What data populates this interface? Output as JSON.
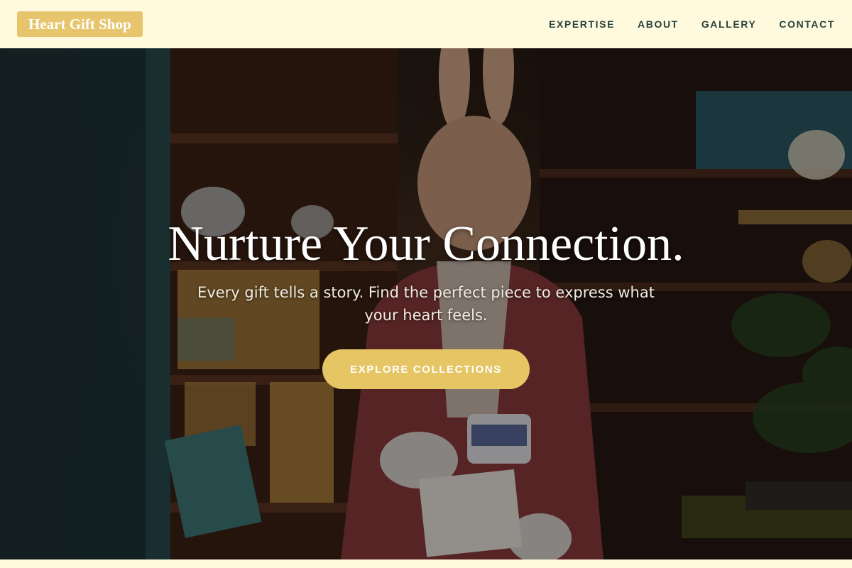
{
  "header": {
    "logo_text": "Heart Gift Shop",
    "nav": [
      {
        "label": "EXPERTISE"
      },
      {
        "label": "ABOUT"
      },
      {
        "label": "GALLERY"
      },
      {
        "label": "CONTACT"
      }
    ]
  },
  "hero": {
    "headline": "Nurture Your Connection.",
    "subtext": "Every gift tells a story. Find the perfect piece to express what your heart feels.",
    "cta_label": "EXPLORE COLLECTIONS",
    "background_description_icon": "shop-interior-rabbit-statue-image"
  },
  "colors": {
    "header_bg": "#fff9dd",
    "logo_bg": "#e7c56c",
    "nav_text": "#27423f",
    "cta_bg": "#e6c565"
  }
}
